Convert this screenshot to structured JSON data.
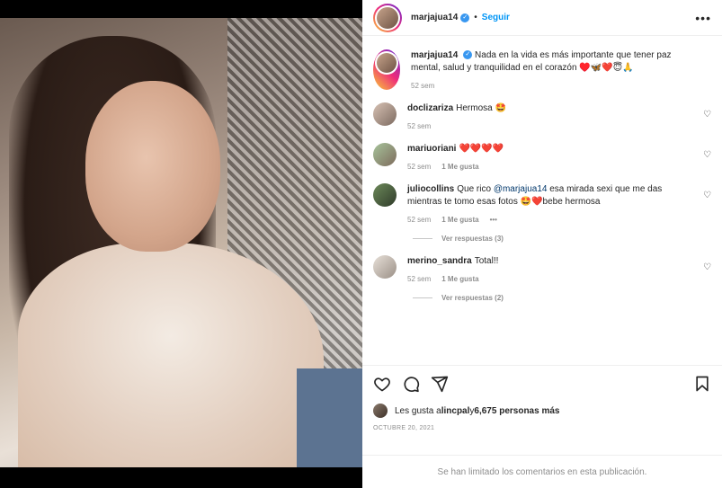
{
  "post": {
    "username": "marjajua14",
    "follow_label": "Seguir",
    "dot": "•",
    "caption": "Nada en la vida es más importante que tener paz mental, salud y tranquilidad en el corazón ♥️🦋❤️😇🙏",
    "caption_time": "52 sem"
  },
  "comments": [
    {
      "username": "doclizariza",
      "text": "Hermosa 🤩",
      "time": "52 sem",
      "likes": ""
    },
    {
      "username": "mariuoriani",
      "text": "❤️❤️❤️❤️",
      "time": "52 sem",
      "likes": "1 Me gusta"
    },
    {
      "username": "juliocollins",
      "text_pre": "Que rico ",
      "mention": "@marjajua14",
      "text_post": " esa mirada sexi que me das mientras te tomo esas fotos 🤩❤️bebe hermosa",
      "time": "52 sem",
      "likes": "1 Me gusta",
      "more": "•••",
      "replies": "Ver respuestas (3)"
    },
    {
      "username": "merino_sandra",
      "text": "Total!!",
      "time": "52 sem",
      "likes": "1 Me gusta",
      "replies": "Ver respuestas (2)"
    }
  ],
  "likes": {
    "prefix": "Les gusta a ",
    "user": "lincpal",
    "middle": " y ",
    "count": "6,675 personas más"
  },
  "date": "OCTUBRE 20, 2021",
  "limited": "Se han limitado los comentarios en esta publicación.",
  "colors": {
    "accent": "#0095f6",
    "verified": "#3897f0",
    "muted": "#8e8e8e"
  }
}
